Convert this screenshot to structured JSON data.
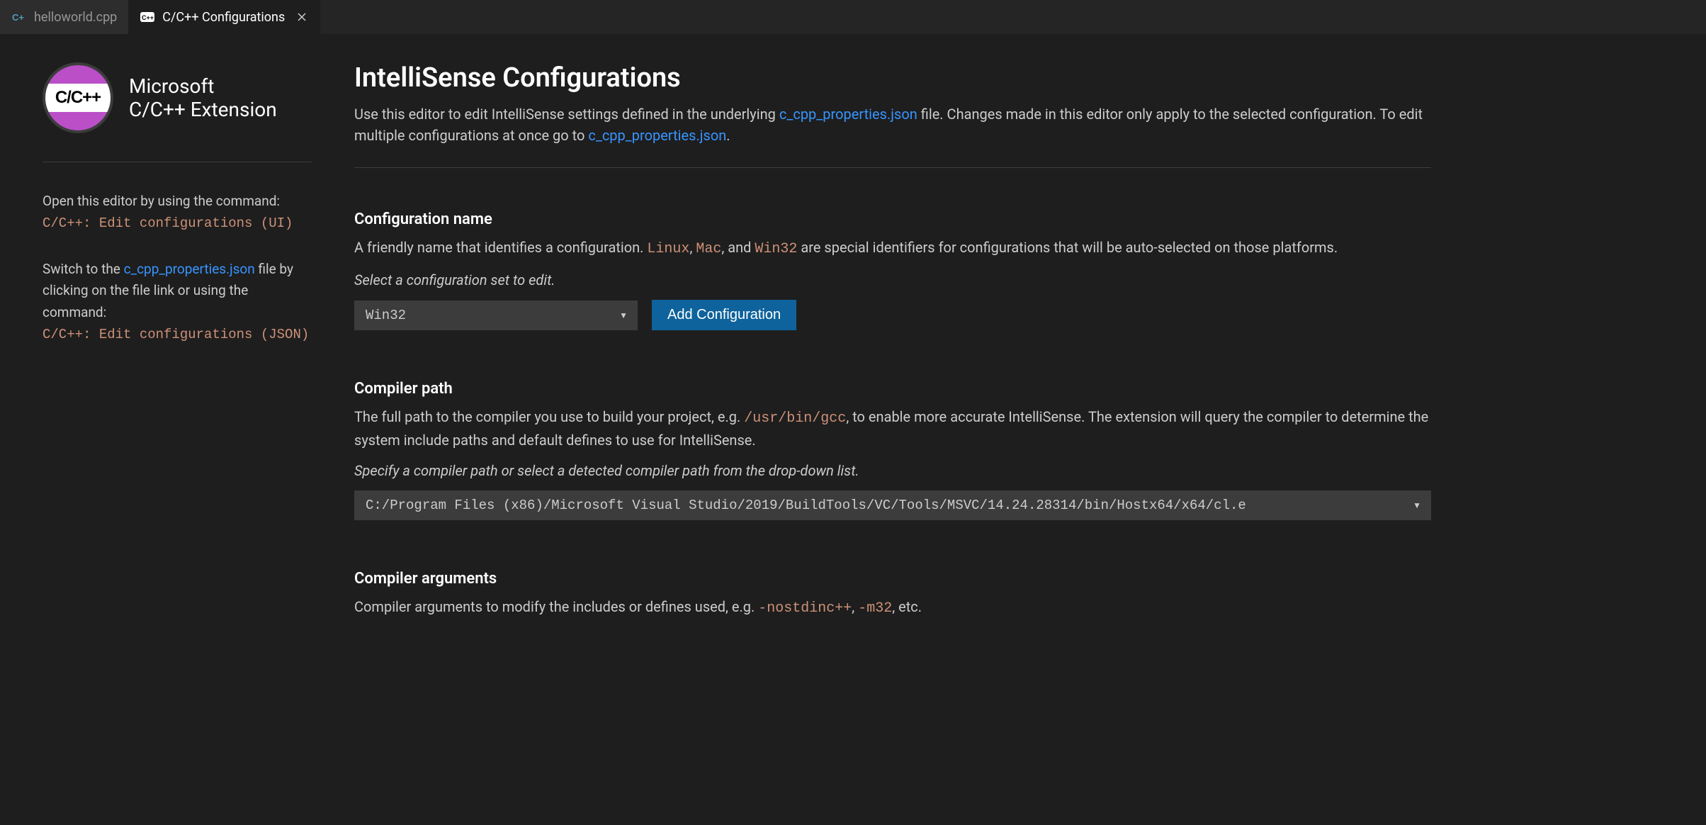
{
  "tabs": [
    {
      "label": "helloworld.cpp",
      "icon": "cpp",
      "active": false
    },
    {
      "label": "C/C++ Configurations",
      "icon": "config",
      "active": true
    }
  ],
  "sidebar": {
    "logo": {
      "text": "C/C++"
    },
    "branding": {
      "title": "Microsoft",
      "subtitle": "C/C++ Extension"
    },
    "open_hint": "Open this editor by using the command:",
    "open_command": "C/C++: Edit configurations (UI)",
    "switch_text_1": "Switch to the ",
    "switch_link": "c_cpp_properties.json",
    "switch_text_2": " file by clicking on the file link or using the command:",
    "switch_command": "C/C++: Edit configurations (JSON)"
  },
  "page": {
    "title": "IntelliSense Configurations",
    "description_1": "Use this editor to edit IntelliSense settings defined in the underlying ",
    "description_link_1": "c_cpp_properties.json",
    "description_2": " file. Changes made in this editor only apply to the selected configuration. To edit multiple configurations at once go to ",
    "description_link_2": "c_cpp_properties.json",
    "description_3": "."
  },
  "config_name": {
    "title": "Configuration name",
    "description_1": "A friendly name that identifies a configuration. ",
    "code_linux": "Linux",
    "description_2": ", ",
    "code_mac": "Mac",
    "description_3": ", and ",
    "code_win32": "Win32",
    "description_4": " are special identifiers for configurations that will be auto-selected on those platforms.",
    "hint": "Select a configuration set to edit.",
    "selected": "Win32",
    "add_button": "Add Configuration"
  },
  "compiler_path": {
    "title": "Compiler path",
    "description_1": "The full path to the compiler you use to build your project, e.g. ",
    "code_gcc": "/usr/bin/gcc",
    "description_2": ", to enable more accurate IntelliSense. The extension will query the compiler to determine the system include paths and default defines to use for IntelliSense.",
    "hint": "Specify a compiler path or select a detected compiler path from the drop-down list.",
    "value": "C:/Program Files (x86)/Microsoft Visual Studio/2019/BuildTools/VC/Tools/MSVC/14.24.28314/bin/Hostx64/x64/cl.e"
  },
  "compiler_args": {
    "title": "Compiler arguments",
    "description_1": "Compiler arguments to modify the includes or defines used, e.g. ",
    "code_nostdinc": "-nostdinc++",
    "description_2": ", ",
    "code_m32": "-m32",
    "description_3": ", etc."
  }
}
